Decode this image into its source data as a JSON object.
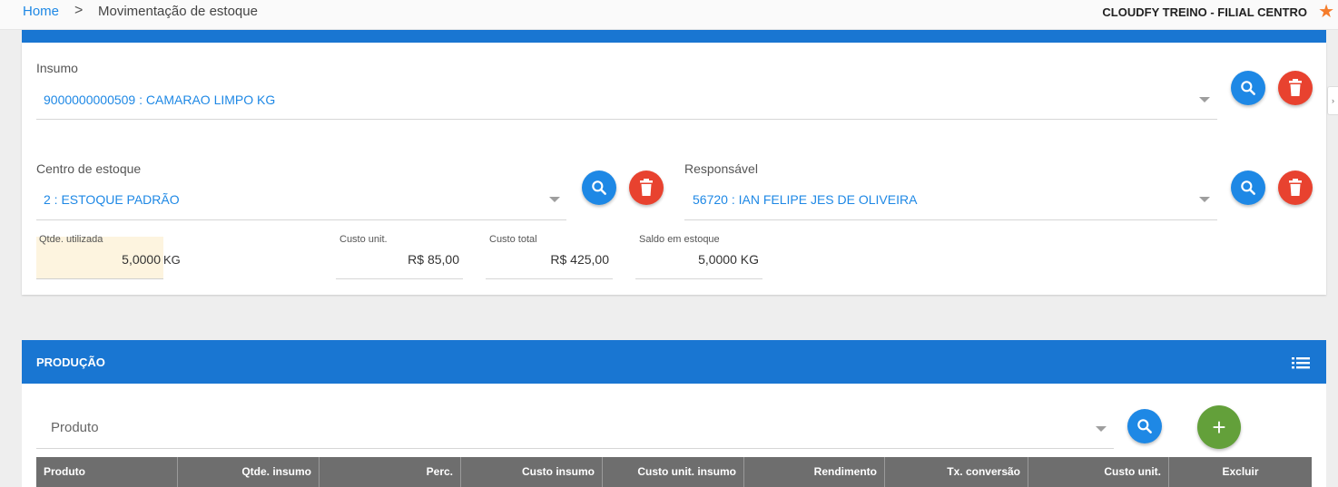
{
  "breadcrumb": {
    "home": "Home",
    "separator": ">",
    "page": "Movimentação de estoque"
  },
  "company": "CLOUDFY TREINO - FILIAL CENTRO",
  "insumo": {
    "label": "Insumo",
    "value": "9000000000509 : CAMARAO LIMPO KG"
  },
  "centro": {
    "label": "Centro de estoque",
    "value": "2 : ESTOQUE PADRÃO"
  },
  "responsavel": {
    "label": "Responsável",
    "value": "56720 : IAN FELIPE JES DE OLIVEIRA"
  },
  "qtd": {
    "label": "Qtde. utilizada",
    "value": "5,0000",
    "unit": "KG"
  },
  "custo_unit": {
    "label": "Custo unit.",
    "value": "R$ 85,00"
  },
  "custo_total": {
    "label": "Custo total",
    "value": "R$ 425,00"
  },
  "saldo": {
    "label": "Saldo em estoque",
    "value": "5,0000 KG"
  },
  "producao": {
    "title": "PRODUÇÃO",
    "produto_placeholder": "Produto",
    "add_label": "+",
    "columns": [
      "Produto",
      "Qtde. insumo",
      "Perc.",
      "Custo insumo",
      "Custo unit. insumo",
      "Rendimento",
      "Tx. conversão",
      "Custo unit.",
      "Excluir"
    ]
  },
  "colors": {
    "primary": "#1976d2",
    "accent_blue": "#1e88e5",
    "danger": "#e8422f",
    "success": "#63a03a",
    "highlight": "#fdf4df"
  },
  "icons": [
    "chevron-right-icon",
    "star-icon",
    "search-icon",
    "trash-icon",
    "list-icon",
    "plus-icon",
    "caret-down-icon"
  ]
}
